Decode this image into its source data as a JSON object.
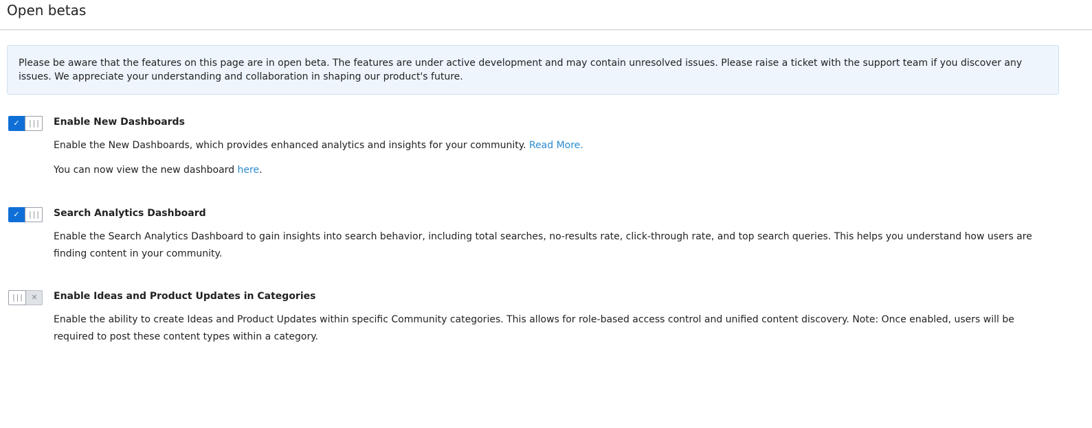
{
  "page": {
    "title": "Open betas"
  },
  "notice": {
    "text": "Please be aware that the features on this page are in open beta. The features are under active development and may contain unresolved issues. Please raise a ticket with the support team if you discover any issues. We appreciate your understanding and collaboration in shaping our product's future."
  },
  "icons": {
    "check": "✓",
    "cross": "✕",
    "grip": "|||"
  },
  "features": [
    {
      "title": "Enable New Dashboards",
      "enabled": true,
      "description": "Enable the New Dashboards, which provides enhanced analytics and insights for your community.",
      "link_label": "Read More.",
      "note_prefix": "You can now view the new dashboard ",
      "note_link": "here",
      "note_suffix": "."
    },
    {
      "title": "Search Analytics Dashboard",
      "enabled": true,
      "description": "Enable the Search Analytics Dashboard to gain insights into search behavior, including total searches, no-results rate, click-through rate, and top search queries. This helps you understand how users are finding content in your community."
    },
    {
      "title": "Enable Ideas and Product Updates in Categories",
      "enabled": false,
      "description": "Enable the ability to create Ideas and Product Updates within specific Community categories. This allows for role-based access control and unified content discovery. Note: Once enabled, users will be required to post these content types within a category."
    }
  ],
  "colors": {
    "accent": "#0f6fd6",
    "link": "#2a8bd0",
    "notice_bg": "#eef5fd"
  }
}
